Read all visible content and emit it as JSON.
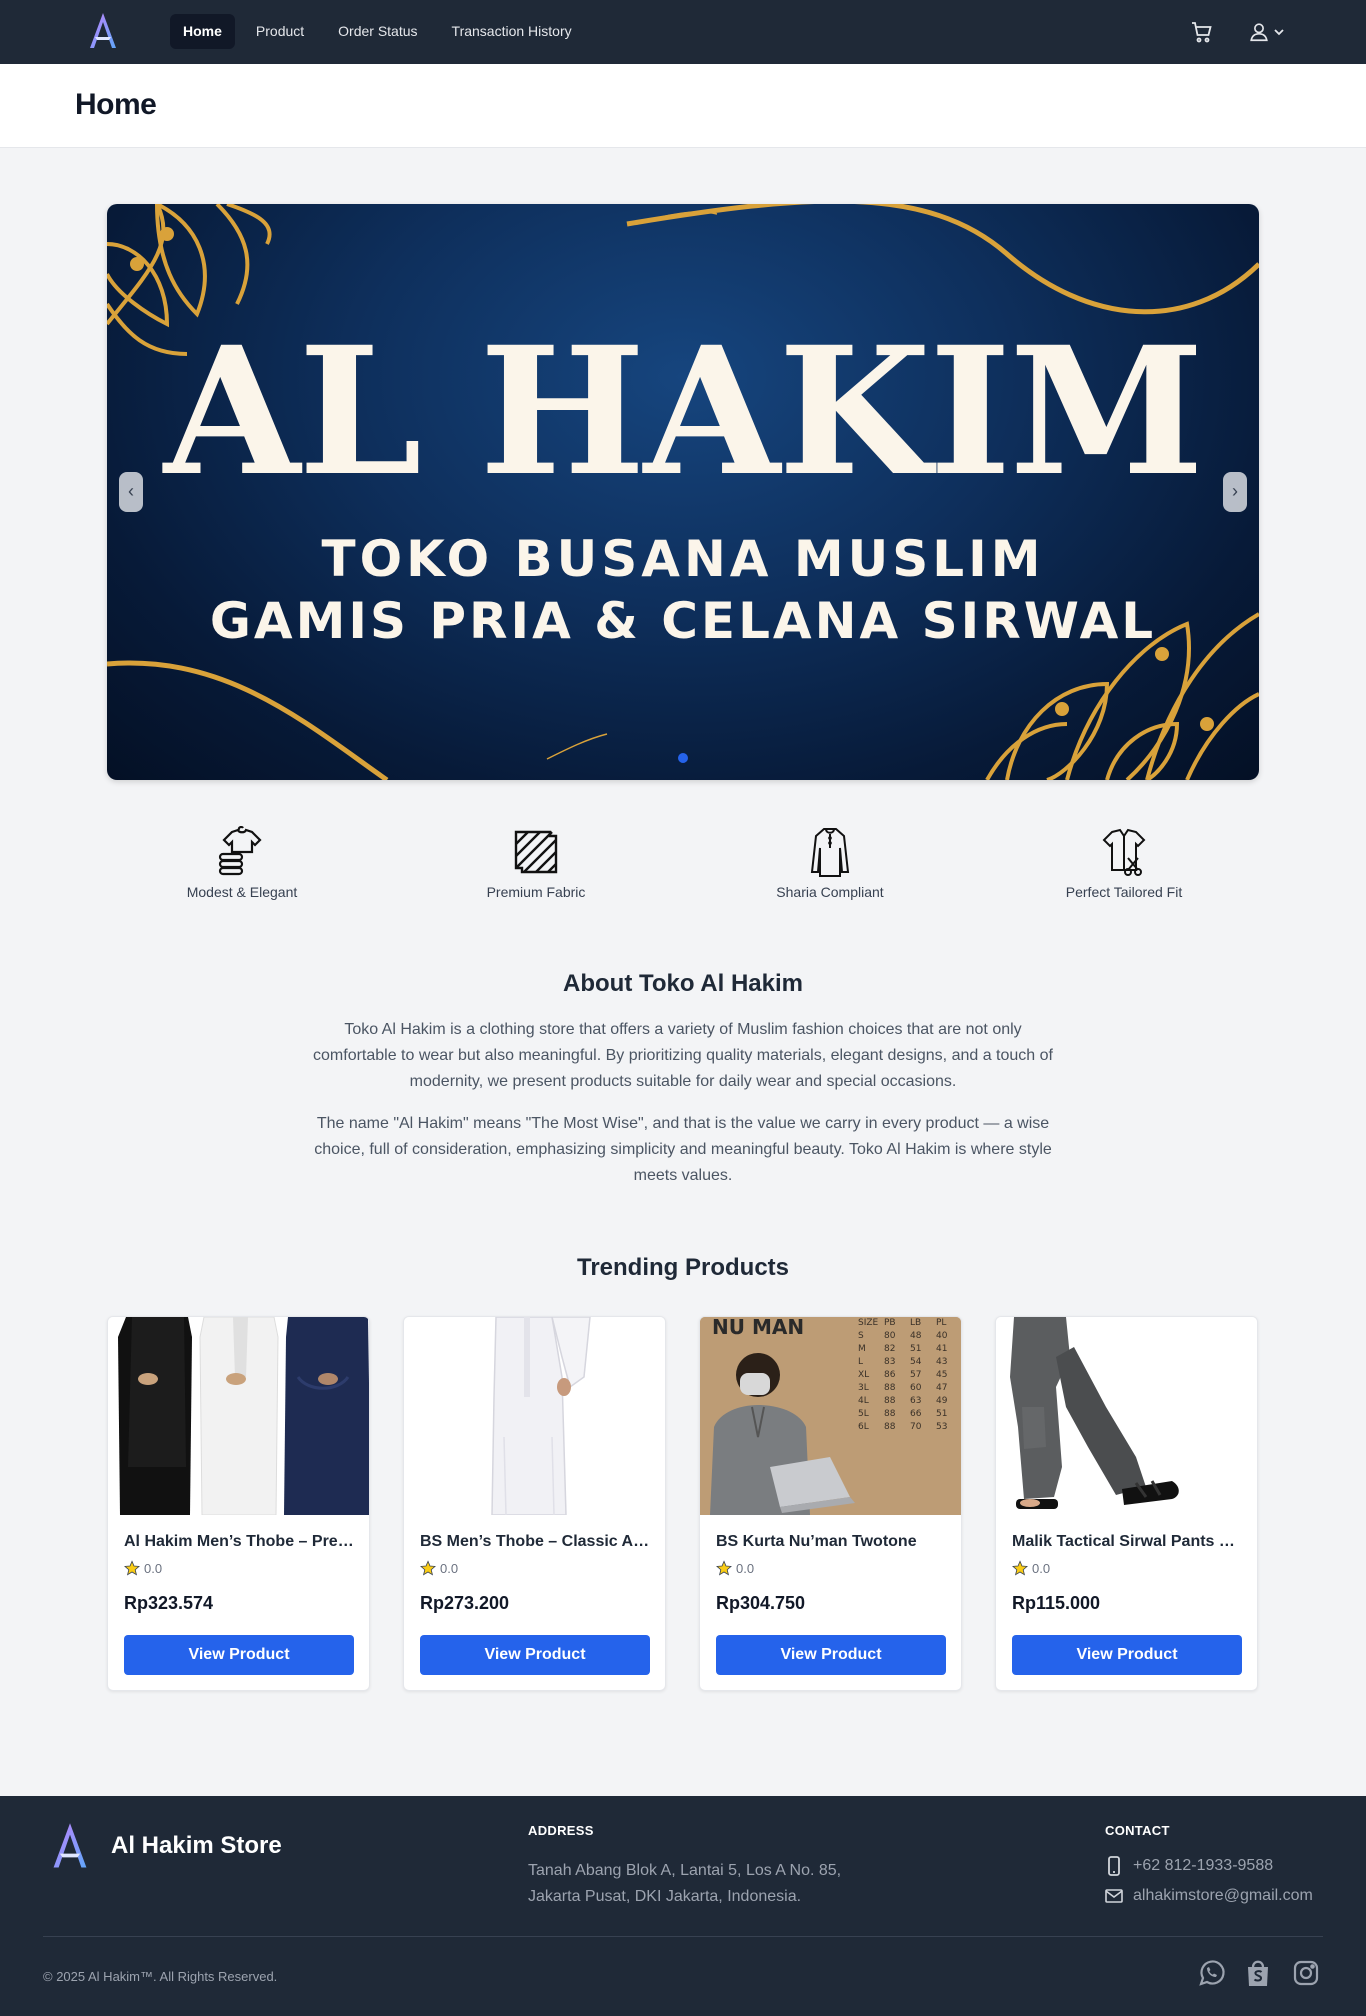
{
  "nav": {
    "items": [
      {
        "label": "Home",
        "active": true
      },
      {
        "label": "Product",
        "active": false
      },
      {
        "label": "Order Status",
        "active": false
      },
      {
        "label": "Transaction History",
        "active": false
      }
    ],
    "icons": [
      "cart-icon",
      "user-icon",
      "chevron-down-icon"
    ]
  },
  "header": {
    "title": "Home"
  },
  "carousel": {
    "title": "AL HAKIM",
    "subtitle_line1": "TOKO BUSANA MUSLIM",
    "subtitle_line2": "GAMIS PRIA & CELANA SIRWAL",
    "prev": "‹",
    "next": "›",
    "slides": 1,
    "active_slide": 1
  },
  "features": [
    {
      "label": "Modest & Elegant",
      "icon": "clothes-stack-icon"
    },
    {
      "label": "Premium Fabric",
      "icon": "fabric-icon"
    },
    {
      "label": "Sharia Compliant",
      "icon": "robe-icon"
    },
    {
      "label": "Perfect Tailored Fit",
      "icon": "tailor-icon"
    }
  ],
  "about": {
    "title": "About Toko Al Hakim",
    "p1": "Toko Al Hakim is a clothing store that offers a variety of Muslim fashion choices that are not only comfortable to wear but also meaningful. By prioritizing quality materials, elegant designs, and a touch of modernity, we present products suitable for daily wear and special occasions.",
    "p2": "The name \"Al Hakim\" means \"The Most Wise\", and that is the value we carry in every product — a wise choice, full of consideration, emphasizing simplicity and meaningful beauty. Toko Al Hakim is where style meets values."
  },
  "trending": {
    "title": "Trending Products",
    "products": [
      {
        "name": "Al Hakim Men’s Thobe – Premium",
        "rating": "0.0",
        "price": "Rp323.574",
        "button": "View Product"
      },
      {
        "name": "BS Men’s Thobe – Classic Arab",
        "rating": "0.0",
        "price": "Rp273.200",
        "button": "View Product"
      },
      {
        "name": "BS Kurta Nu’man Twotone",
        "rating": "0.0",
        "price": "Rp304.750",
        "button": "View Product",
        "image_text": "NU MAN"
      },
      {
        "name": "Malik Tactical Sirwal Pants Premium",
        "rating": "0.0",
        "price": "Rp115.000",
        "button": "View Product"
      }
    ],
    "size_chart": {
      "header": [
        "SIZE",
        "PB",
        "LB",
        "PL"
      ],
      "rows": [
        [
          "S",
          "80",
          "48",
          "40"
        ],
        [
          "M",
          "82",
          "51",
          "41"
        ],
        [
          "L",
          "83",
          "54",
          "43"
        ],
        [
          "XL",
          "86",
          "57",
          "45"
        ],
        [
          "3L",
          "88",
          "60",
          "47"
        ],
        [
          "4L",
          "88",
          "63",
          "49"
        ],
        [
          "5L",
          "88",
          "66",
          "51"
        ],
        [
          "6L",
          "88",
          "70",
          "53"
        ]
      ]
    }
  },
  "footer": {
    "brand": "Al Hakim Store",
    "address_heading": "ADDRESS",
    "address": "Tanah Abang Blok A, Lantai 5, Los A No. 85, Jakarta Pusat, DKI Jakarta, Indonesia.",
    "contact_heading": "CONTACT",
    "phone": "+62 812-1933-9588",
    "email": "alhakimstore@gmail.com",
    "copyright": "© 2025 Al Hakim™. All Rights Reserved.",
    "socials": [
      "whatsapp-icon",
      "shopee-icon",
      "instagram-icon"
    ]
  },
  "colors": {
    "navbar": "#1f2937",
    "accent": "#2563eb",
    "gold": "#d9a23a",
    "banner_navy": "#0e2f5c",
    "background": "#f3f4f6"
  }
}
